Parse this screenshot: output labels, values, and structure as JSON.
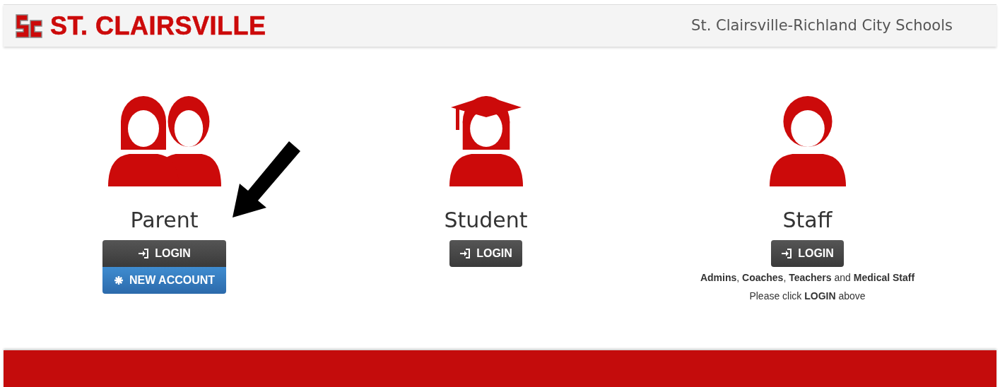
{
  "header": {
    "logo_text": "ST. CLAIRSVILLE",
    "district": "St. Clairsville-Richland City Schools"
  },
  "roles": [
    {
      "kind": "parent",
      "title": "Parent",
      "buttons": [
        {
          "kind": "login",
          "label": "LOGIN"
        },
        {
          "kind": "new_account",
          "label": "NEW ACCOUNT"
        }
      ]
    },
    {
      "kind": "student",
      "title": "Student",
      "buttons": [
        {
          "kind": "login",
          "label": "LOGIN"
        }
      ]
    },
    {
      "kind": "staff",
      "title": "Staff",
      "buttons": [
        {
          "kind": "login",
          "label": "LOGIN"
        }
      ],
      "notes": [
        "**Admins**, **Coaches**, **Teachers** and **Medical Staff**",
        "Please click **LOGIN** above"
      ]
    }
  ]
}
